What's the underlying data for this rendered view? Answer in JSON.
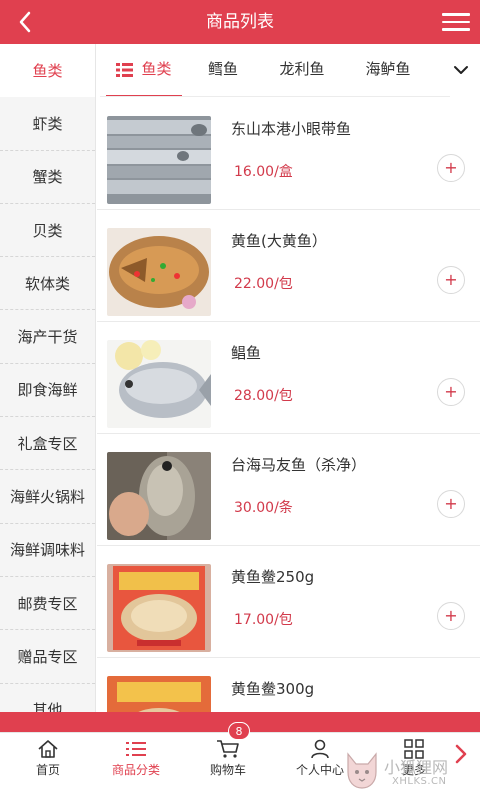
{
  "header": {
    "title": "商品列表",
    "back_icon": "chevron-left-icon",
    "menu_icon": "hamburger-menu-icon",
    "color": "#e0404f"
  },
  "sidebar": {
    "items": [
      {
        "label": "鱼类",
        "active": true
      },
      {
        "label": "虾类"
      },
      {
        "label": "蟹类"
      },
      {
        "label": "贝类"
      },
      {
        "label": "软体类"
      },
      {
        "label": "海产干货"
      },
      {
        "label": "即食海鲜"
      },
      {
        "label": "礼盒专区"
      },
      {
        "label": "海鲜火锅料"
      },
      {
        "label": "海鲜调味料"
      },
      {
        "label": "邮费专区"
      },
      {
        "label": "赠品专区"
      },
      {
        "label": "其他"
      }
    ]
  },
  "tabs": {
    "items": [
      {
        "label": "鱼类",
        "active": true
      },
      {
        "label": "鳕鱼"
      },
      {
        "label": "龙利鱼"
      },
      {
        "label": "海鲈鱼"
      }
    ],
    "more_icon": "chevron-down-icon"
  },
  "products": [
    {
      "name": "东山本港小眼带鱼",
      "price": "16.00/盒",
      "add": "+"
    },
    {
      "name": "黄鱼(大黄鱼）",
      "price": "22.00/包",
      "add": "+"
    },
    {
      "name": "鲳鱼",
      "price": "28.00/包",
      "add": "+"
    },
    {
      "name": "台海马友鱼（杀净）",
      "price": "30.00/条",
      "add": "+"
    },
    {
      "name": "黄鱼鲞250g",
      "price": "17.00/包",
      "add": "+"
    },
    {
      "name": "黄鱼鲞300g",
      "price": "",
      "add": ""
    }
  ],
  "bottom_nav": {
    "items": [
      {
        "label": "首页",
        "icon": "home-icon"
      },
      {
        "label": "商品分类",
        "icon": "list-icon",
        "active": true
      },
      {
        "label": "购物车",
        "icon": "cart-icon"
      },
      {
        "label": "个人中心",
        "icon": "user-icon"
      },
      {
        "label": "更多",
        "icon": "grid-icon"
      }
    ],
    "cart_badge": "8",
    "next_icon": "chevron-right-icon"
  },
  "watermark": {
    "text": "小狐狸网",
    "url": "XHLKS.CN"
  }
}
